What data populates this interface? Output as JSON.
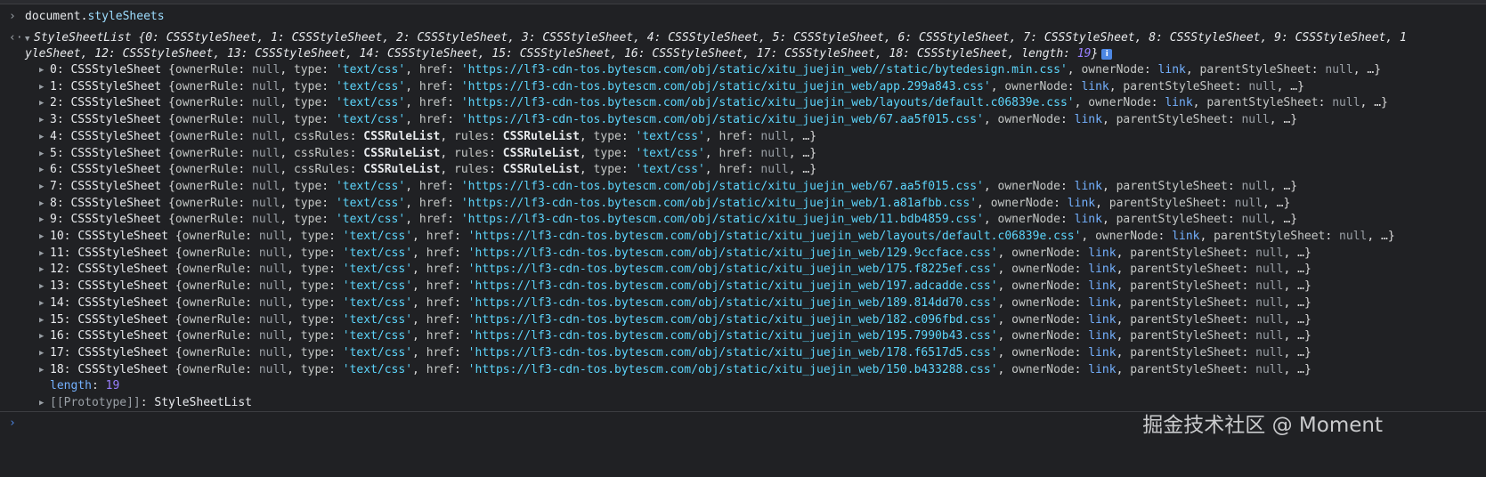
{
  "command": {
    "prefix": "document.",
    "prop": "styleSheets"
  },
  "result": {
    "line1_text": "StyleSheetList {0: CSSStyleSheet, 1: CSSStyleSheet, 2: CSSStyleSheet, 3: CSSStyleSheet, 4: CSSStyleSheet, 5: CSSStyleSheet, 6: CSSStyleSheet, 7: CSSStyleSheet, 8: CSSStyleSheet, 9: CSSStyleSheet, 1",
    "line2_text": "yleSheet, 12: CSSStyleSheet, 13: CSSStyleSheet, 14: CSSStyleSheet, 15: CSSStyleSheet, 16: CSSStyleSheet, 17: CSSStyleSheet, 18: CSSStyleSheet, ",
    "line2_length_key": "length: ",
    "line2_length_val": "19",
    "line2_close": "}",
    "info_badge": "i"
  },
  "items": [
    {
      "index": "0",
      "kind": "href",
      "href": "https://lf3-cdn-tos.bytescm.com/obj/static/xitu_juejin_web//static/bytedesign.min.css"
    },
    {
      "index": "1",
      "kind": "href",
      "href": "https://lf3-cdn-tos.bytescm.com/obj/static/xitu_juejin_web/app.299a843.css"
    },
    {
      "index": "2",
      "kind": "href",
      "href": "https://lf3-cdn-tos.bytescm.com/obj/static/xitu_juejin_web/layouts/default.c06839e.css"
    },
    {
      "index": "3",
      "kind": "href",
      "href": "https://lf3-cdn-tos.bytescm.com/obj/static/xitu_juejin_web/67.aa5f015.css"
    },
    {
      "index": "4",
      "kind": "rules"
    },
    {
      "index": "5",
      "kind": "rules"
    },
    {
      "index": "6",
      "kind": "rules"
    },
    {
      "index": "7",
      "kind": "href",
      "href": "https://lf3-cdn-tos.bytescm.com/obj/static/xitu_juejin_web/67.aa5f015.css"
    },
    {
      "index": "8",
      "kind": "href",
      "href": "https://lf3-cdn-tos.bytescm.com/obj/static/xitu_juejin_web/1.a81afbb.css"
    },
    {
      "index": "9",
      "kind": "href",
      "href": "https://lf3-cdn-tos.bytescm.com/obj/static/xitu_juejin_web/11.bdb4859.css"
    },
    {
      "index": "10",
      "kind": "href",
      "href": "https://lf3-cdn-tos.bytescm.com/obj/static/xitu_juejin_web/layouts/default.c06839e.css"
    },
    {
      "index": "11",
      "kind": "href",
      "href": "https://lf3-cdn-tos.bytescm.com/obj/static/xitu_juejin_web/129.9ccface.css"
    },
    {
      "index": "12",
      "kind": "href",
      "href": "https://lf3-cdn-tos.bytescm.com/obj/static/xitu_juejin_web/175.f8225ef.css"
    },
    {
      "index": "13",
      "kind": "href",
      "href": "https://lf3-cdn-tos.bytescm.com/obj/static/xitu_juejin_web/197.adcadde.css"
    },
    {
      "index": "14",
      "kind": "href",
      "href": "https://lf3-cdn-tos.bytescm.com/obj/static/xitu_juejin_web/189.814dd70.css"
    },
    {
      "index": "15",
      "kind": "href",
      "href": "https://lf3-cdn-tos.bytescm.com/obj/static/xitu_juejin_web/182.c096fbd.css"
    },
    {
      "index": "16",
      "kind": "href",
      "href": "https://lf3-cdn-tos.bytescm.com/obj/static/xitu_juejin_web/195.7990b43.css"
    },
    {
      "index": "17",
      "kind": "href",
      "href": "https://lf3-cdn-tos.bytescm.com/obj/static/xitu_juejin_web/178.f6517d5.css"
    },
    {
      "index": "18",
      "kind": "href",
      "href": "https://lf3-cdn-tos.bytescm.com/obj/static/xitu_juejin_web/150.b433288.css"
    }
  ],
  "strings": {
    "class_name": "CSSStyleSheet",
    "owner_rule": "ownerRule",
    "type_key": "type",
    "type_val": "'text/css'",
    "href_key": "href",
    "owner_node_key": "ownerNode",
    "owner_node_val": "link",
    "parent_key": "parentStyleSheet",
    "null": "null",
    "ellipsis": "…",
    "css_rules_key": "cssRules",
    "rules_key": "rules",
    "rule_list": "CSSRuleList"
  },
  "footer": {
    "length_key": "length",
    "length_val": "19",
    "proto_key": "[[Prototype]]",
    "proto_val": "StyleSheetList"
  },
  "watermark": "掘金技术社区 @ Moment",
  "colors": {
    "background": "#202124",
    "string": "#5cd5fb",
    "number": "#9980ff",
    "link": "#74b1ff",
    "prop": "#9cdcfe"
  },
  "icons": {
    "prompt": "chevron-right-icon",
    "result": "chevron-left-icon",
    "expand": "triangle-right-icon",
    "info": "info-icon"
  }
}
